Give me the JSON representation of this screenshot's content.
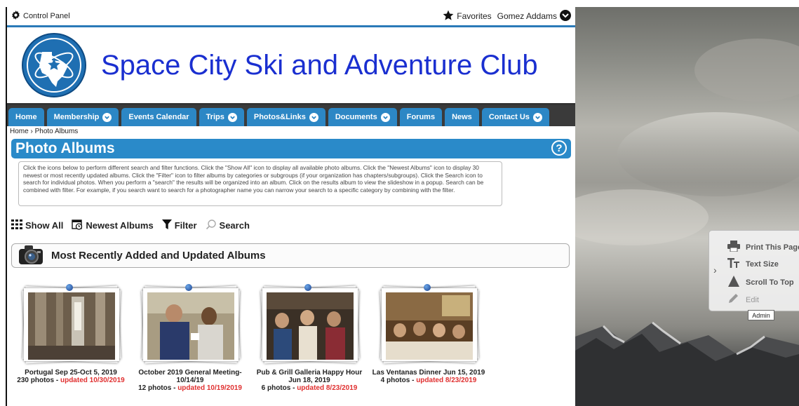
{
  "topbar": {
    "control_panel": "Control Panel",
    "favorites": "Favorites",
    "user": "Gomez Addams"
  },
  "header": {
    "title": "Space City Ski and Adventure Club"
  },
  "nav": {
    "items": [
      {
        "label": "Home",
        "has_menu": false
      },
      {
        "label": "Membership",
        "has_menu": true
      },
      {
        "label": "Events Calendar",
        "has_menu": false
      },
      {
        "label": "Trips",
        "has_menu": true
      },
      {
        "label": "Photos&Links",
        "has_menu": true
      },
      {
        "label": "Documents",
        "has_menu": true
      },
      {
        "label": "Forums",
        "has_menu": false
      },
      {
        "label": "News",
        "has_menu": false
      },
      {
        "label": "Contact Us",
        "has_menu": true
      }
    ]
  },
  "breadcrumb": {
    "home": "Home",
    "separator": "›",
    "current": "Photo Albums"
  },
  "page": {
    "title": "Photo Albums",
    "help": "?",
    "instructions": "Click the icons below to perform different search and filter functions. Click the \"Show All\" icon to display all available photo albums. Click the \"Newest Albums\" icon to display 30 newest or most recently updated albums. Click the \"Filter\" icon to filter albums by categories or subgroups (if your organization has chapters/subgroups). Click the Search icon to search for individual photos. When you perform a \"search\" the results will be organized into an album. Click on the results album to view the slideshow in a popup. Search can be combined with filter. For example, if you search want to search for a photographer name you can narrow your search to a specific category by combining with the filter."
  },
  "toolbar": {
    "show_all": "Show All",
    "newest": "Newest Albums",
    "filter": "Filter",
    "search": "Search"
  },
  "section": {
    "title": "Most Recently Added and Updated Albums"
  },
  "albums": [
    {
      "title": "Portugal Sep 25-Oct 5, 2019",
      "count": "230 photos",
      "sep": " - ",
      "updated": "updated 10/30/2019"
    },
    {
      "title": "October 2019 General Meeting- 10/14/19",
      "count": "12 photos",
      "sep": " - ",
      "updated": "updated 10/19/2019"
    },
    {
      "title": "Pub & Grill Galleria Happy Hour Jun 18, 2019",
      "count": "6 photos",
      "sep": " - ",
      "updated": "updated 8/23/2019"
    },
    {
      "title": "Las Ventanas Dinner Jun 15, 2019",
      "count": "4 photos",
      "sep": " - ",
      "updated": "updated 8/23/2019"
    }
  ],
  "tools_panel": {
    "toggle": "›",
    "print": "Print This Page",
    "text_size": "Text Size",
    "scroll_top": "Scroll To Top",
    "edit": "Edit",
    "tooltip": "Admin"
  },
  "colors": {
    "accent": "#2a8ac9",
    "title_blue": "#1a2fd0",
    "update_red": "#e03030"
  }
}
